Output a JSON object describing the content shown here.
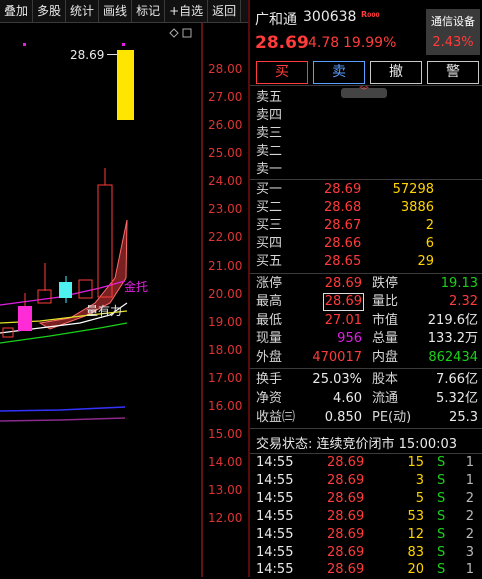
{
  "toolbar": {
    "items": [
      "叠加",
      "多股",
      "统计",
      "画线",
      "标记",
      "+自选",
      "返回"
    ]
  },
  "chart": {
    "price_labels": [
      "28.00",
      "27.00",
      "26.00",
      "25.00",
      "24.00",
      "23.00",
      "22.00",
      "21.00",
      "20.00",
      "19.00",
      "18.00",
      "17.00",
      "16.00",
      "15.00",
      "14.00",
      "13.00",
      "12.00"
    ],
    "high_label": "28.69",
    "annotation_jintuo": "金托",
    "annotation_liang": "量有力",
    "colors": {
      "up": "#ff3b3b",
      "down": "#1ad11a",
      "axis": "#cc2222"
    }
  },
  "quote": {
    "name": "广和通",
    "code": "300638",
    "badge": "R",
    "price": "28.69",
    "change": "4.78",
    "change_pct": "19.99%",
    "sector": "通信设备",
    "sector_pct": "2.43%"
  },
  "actions": {
    "buy": "买",
    "sell": "卖",
    "cancel": "撤",
    "alert": "警"
  },
  "sell_levels": [
    "卖五",
    "卖四",
    "卖三",
    "卖二",
    "卖一"
  ],
  "buy_levels": [
    {
      "label": "买一",
      "price": "28.69",
      "vol": "57298"
    },
    {
      "label": "买二",
      "price": "28.68",
      "vol": "3886"
    },
    {
      "label": "买三",
      "price": "28.67",
      "vol": "2"
    },
    {
      "label": "买四",
      "price": "28.66",
      "vol": "6"
    },
    {
      "label": "买五",
      "price": "28.65",
      "vol": "29"
    }
  ],
  "stats": {
    "zhangting_label": "涨停",
    "zhangting": "28.69",
    "dieting_label": "跌停",
    "dieting": "19.13",
    "zuigao_label": "最高",
    "zuigao": "28.69",
    "liangbi_label": "量比",
    "liangbi": "2.32",
    "zuidi_label": "最低",
    "zuidi": "27.01",
    "shizhi_label": "市值",
    "shizhi": "219.6亿",
    "xianliang_label": "现量",
    "xianliang": "956",
    "zongliang_label": "总量",
    "zongliang": "133.2万",
    "waipan_label": "外盘",
    "waipan": "470017",
    "neipan_label": "内盘",
    "neipan": "862434",
    "huanshou_label": "换手",
    "huanshou": "25.03%",
    "guben_label": "股本",
    "guben": "7.66亿",
    "jingzi_label": "净资",
    "jingzi": "4.60",
    "liutong_label": "流通",
    "liutong": "5.32亿",
    "shouyi_label": "收益㈢",
    "shouyi": "0.850",
    "pe_label": "PE(动)",
    "pe": "25.3"
  },
  "trade_status": "交易状态: 连续竞价闭市 15:00:03",
  "ticks": [
    {
      "time": "14:55",
      "price": "28.69",
      "vol": "15",
      "side": "S",
      "n": "1"
    },
    {
      "time": "14:55",
      "price": "28.69",
      "vol": "3",
      "side": "S",
      "n": "1"
    },
    {
      "time": "14:55",
      "price": "28.69",
      "vol": "5",
      "side": "S",
      "n": "2"
    },
    {
      "time": "14:55",
      "price": "28.69",
      "vol": "53",
      "side": "S",
      "n": "2"
    },
    {
      "time": "14:55",
      "price": "28.69",
      "vol": "12",
      "side": "S",
      "n": "2"
    },
    {
      "time": "14:55",
      "price": "28.69",
      "vol": "83",
      "side": "S",
      "n": "3"
    },
    {
      "time": "14:55",
      "price": "28.69",
      "vol": "20",
      "side": "S",
      "n": "1"
    }
  ]
}
